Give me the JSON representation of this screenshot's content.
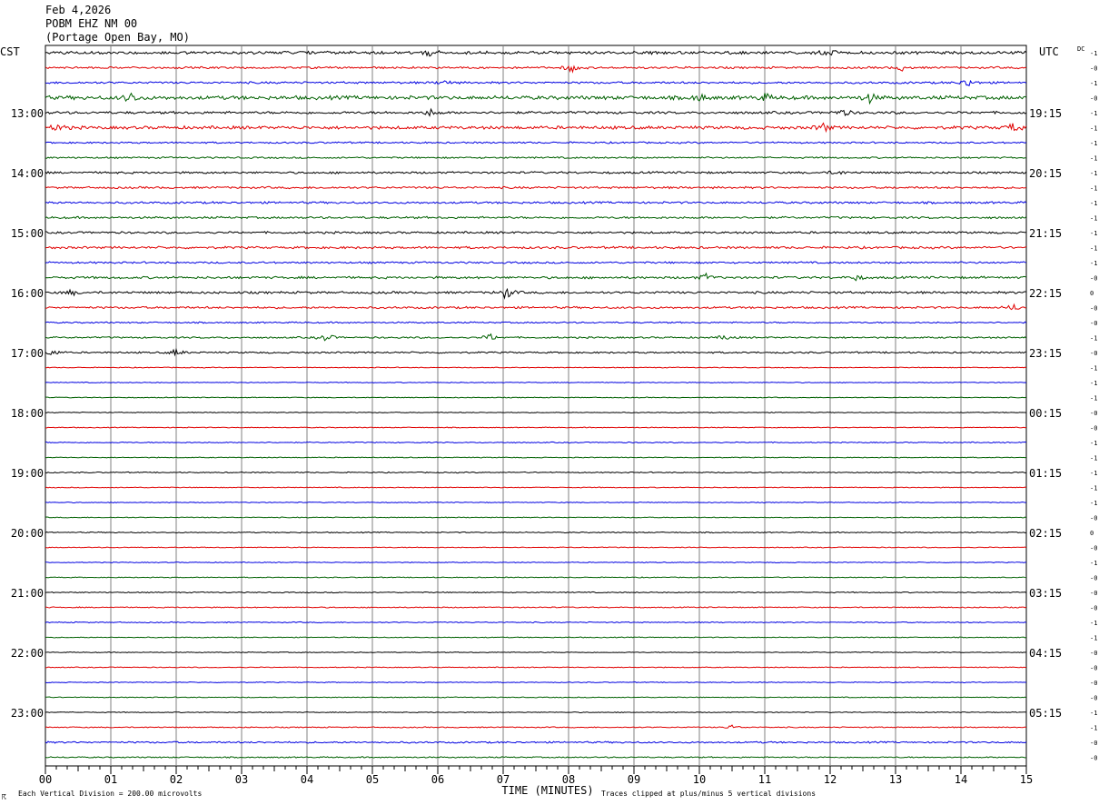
{
  "header": {
    "date": "Feb 4,2026",
    "station": "POBM EHZ NM 00",
    "location": "(Portage Open Bay, MO)"
  },
  "left_zone": "CST",
  "right_zone": "UTC",
  "dc_label": "DC",
  "footer": {
    "division_note": "Each Vertical Division =  200.00 microvolts",
    "clip_note": "Traces clipped at plus/minus 5 vertical divisions",
    "corner_mark": "☈"
  },
  "colors": {
    "trace_cycle": [
      "#000000",
      "#e00000",
      "#0000e0",
      "#006000"
    ],
    "grid": "#808080",
    "frame": "#000000"
  },
  "chart_data": {
    "type": "line",
    "title": "",
    "xlabel": "TIME (MINUTES)",
    "ylabel": "",
    "xlim": [
      0,
      15
    ],
    "x_ticks": [
      "00",
      "01",
      "02",
      "03",
      "04",
      "05",
      "06",
      "07",
      "08",
      "09",
      "10",
      "11",
      "12",
      "13",
      "14",
      "15"
    ],
    "trace_count": 48,
    "left_hour_labels": [
      {
        "row": 4,
        "label": "13:00"
      },
      {
        "row": 8,
        "label": "14:00"
      },
      {
        "row": 12,
        "label": "15:00"
      },
      {
        "row": 16,
        "label": "16:00"
      },
      {
        "row": 20,
        "label": "17:00"
      },
      {
        "row": 24,
        "label": "18:00"
      },
      {
        "row": 28,
        "label": "19:00"
      },
      {
        "row": 32,
        "label": "20:00"
      },
      {
        "row": 36,
        "label": "21:00"
      },
      {
        "row": 40,
        "label": "22:00"
      },
      {
        "row": 44,
        "label": "23:00"
      }
    ],
    "right_hour_labels": [
      {
        "row": 4,
        "label": "19:15"
      },
      {
        "row": 8,
        "label": "20:15"
      },
      {
        "row": 12,
        "label": "21:15"
      },
      {
        "row": 16,
        "label": "22:15"
      },
      {
        "row": 20,
        "label": "23:15"
      },
      {
        "row": 24,
        "label": "00:15"
      },
      {
        "row": 28,
        "label": "01:15"
      },
      {
        "row": 32,
        "label": "02:15"
      },
      {
        "row": 36,
        "label": "03:15"
      },
      {
        "row": 40,
        "label": "04:15"
      },
      {
        "row": 44,
        "label": "05:15"
      }
    ],
    "dc_offsets": [
      "-1",
      "-0",
      "-1",
      "-0",
      "-1",
      "-1",
      "-1",
      "-1",
      "-1",
      "-1",
      "-1",
      "-1",
      "-1",
      "-1",
      "-1",
      "-0",
      "0",
      "-0",
      "-0",
      "-1",
      "-0",
      "-1",
      "-1",
      "-1",
      "-0",
      "-0",
      "-1",
      "-1",
      "-1",
      "-1",
      "-1",
      "-0",
      "0",
      "-0",
      "-1",
      "-0",
      "-0",
      "-0",
      "-1",
      "-1",
      "-0",
      "-0",
      "-0",
      "-0",
      "-1",
      "-1",
      "-0",
      "-0"
    ],
    "trace_amplitude": [
      1.4,
      1.0,
      1.0,
      1.8,
      1.2,
      1.5,
      0.8,
      0.8,
      1.0,
      1.0,
      1.0,
      1.0,
      1.0,
      1.1,
      0.9,
      1.1,
      1.1,
      1.0,
      0.7,
      0.8,
      0.8,
      0.4,
      0.4,
      0.4,
      0.4,
      0.4,
      0.5,
      0.4,
      0.5,
      0.4,
      0.4,
      0.4,
      0.5,
      0.4,
      0.4,
      0.4,
      0.5,
      0.5,
      0.5,
      0.4,
      0.4,
      0.4,
      0.4,
      0.4,
      0.4,
      0.5,
      0.8,
      0.6
    ],
    "events": [
      {
        "row": 0,
        "minute": 5.9,
        "amp": 4
      },
      {
        "row": 0,
        "minute": 12.0,
        "amp": 3
      },
      {
        "row": 1,
        "minute": 8.05,
        "amp": 5
      },
      {
        "row": 1,
        "minute": 13.1,
        "amp": 3
      },
      {
        "row": 2,
        "minute": 6.1,
        "amp": 3
      },
      {
        "row": 2,
        "minute": 14.1,
        "amp": 5
      },
      {
        "row": 3,
        "minute": 1.3,
        "amp": 6
      },
      {
        "row": 3,
        "minute": 10.0,
        "amp": 4
      },
      {
        "row": 3,
        "minute": 11.0,
        "amp": 4
      },
      {
        "row": 3,
        "minute": 12.6,
        "amp": 5
      },
      {
        "row": 4,
        "minute": 5.9,
        "amp": 4
      },
      {
        "row": 4,
        "minute": 12.2,
        "amp": 4
      },
      {
        "row": 5,
        "minute": 0.2,
        "amp": 4
      },
      {
        "row": 5,
        "minute": 11.9,
        "amp": 5
      },
      {
        "row": 5,
        "minute": 14.8,
        "amp": 5
      },
      {
        "row": 8,
        "minute": 12.1,
        "amp": 3
      },
      {
        "row": 15,
        "minute": 10.1,
        "amp": 4
      },
      {
        "row": 15,
        "minute": 12.4,
        "amp": 3
      },
      {
        "row": 16,
        "minute": 0.4,
        "amp": 3
      },
      {
        "row": 16,
        "minute": 7.05,
        "amp": 7
      },
      {
        "row": 17,
        "minute": 14.8,
        "amp": 4
      },
      {
        "row": 19,
        "minute": 4.3,
        "amp": 5
      },
      {
        "row": 19,
        "minute": 6.8,
        "amp": 4
      },
      {
        "row": 19,
        "minute": 10.4,
        "amp": 3
      },
      {
        "row": 20,
        "minute": 0.1,
        "amp": 4
      },
      {
        "row": 20,
        "minute": 2.0,
        "amp": 4
      },
      {
        "row": 45,
        "minute": 10.5,
        "amp": 2.5
      }
    ]
  }
}
